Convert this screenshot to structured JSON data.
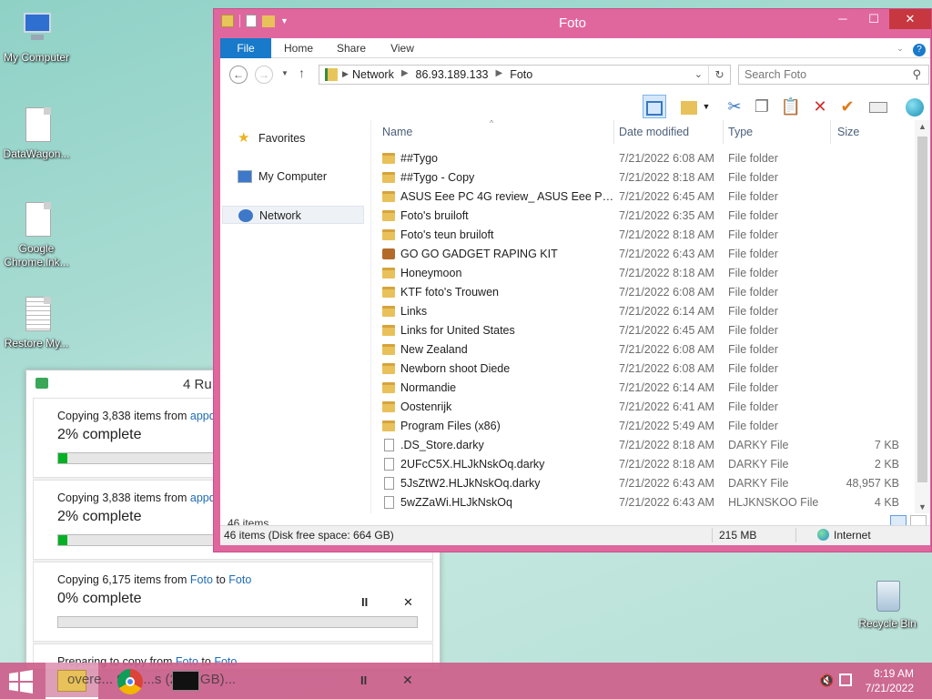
{
  "desktop": {
    "icons": [
      {
        "label": "My Computer"
      },
      {
        "label": "DataWagon..."
      },
      {
        "label": "Google Chrome.lnk..."
      },
      {
        "label": "Restore My..."
      }
    ],
    "recycle_bin": "Recycle Bin"
  },
  "copy_dialog": {
    "title": "4 Ru",
    "items": [
      {
        "prefix": "Copying 3,838 items from ",
        "source": "appda",
        "to": "",
        "dest": "",
        "percent_text": "2% complete",
        "progress": 0.025
      },
      {
        "prefix": "Copying 3,838 items from ",
        "source": "appda",
        "to": "",
        "dest": "",
        "percent_text": "2% complete",
        "progress": 0.025
      },
      {
        "prefix": "Copying 6,175 items from ",
        "source": "Foto",
        "to": " to ",
        "dest": "Foto",
        "percent_text": "0% complete",
        "progress": 0.0
      },
      {
        "prefix": "Preparing to copy from ",
        "source": "Foto",
        "to": " to ",
        "dest": "Foto",
        "percent_text": "",
        "progress": 0.0
      }
    ],
    "pause_icon": "II",
    "close_icon": "✕"
  },
  "explorer": {
    "title": "Foto",
    "tabs": {
      "file": "File",
      "home": "Home",
      "share": "Share",
      "view": "View"
    },
    "address": {
      "crumbs": [
        "Network",
        "86.93.189.133",
        "Foto"
      ]
    },
    "search": {
      "placeholder": "Search Foto"
    },
    "nav": {
      "favorites": "Favorites",
      "my_computer": "My Computer",
      "network": "Network"
    },
    "columns": {
      "name": "Name",
      "date": "Date modified",
      "type": "Type",
      "size": "Size"
    },
    "rows": [
      {
        "icon": "folder",
        "name": "##Tygo",
        "date": "7/21/2022 6:08 AM",
        "type": "File folder",
        "size": ""
      },
      {
        "icon": "folder",
        "name": "##Tygo - Copy",
        "date": "7/21/2022 8:18 AM",
        "type": "File folder",
        "size": ""
      },
      {
        "icon": "folder",
        "name": "ASUS Eee PC 4G review_ ASUS Eee PC 4G ...",
        "date": "7/21/2022 6:45 AM",
        "type": "File folder",
        "size": ""
      },
      {
        "icon": "folder",
        "name": "Foto's bruiloft",
        "date": "7/21/2022 6:35 AM",
        "type": "File folder",
        "size": ""
      },
      {
        "icon": "folder",
        "name": "Foto's teun bruiloft",
        "date": "7/21/2022 8:18 AM",
        "type": "File folder",
        "size": ""
      },
      {
        "icon": "package",
        "name": "GO GO GADGET RAPING KIT",
        "date": "7/21/2022 6:43 AM",
        "type": "File folder",
        "size": ""
      },
      {
        "icon": "folder",
        "name": "Honeymoon",
        "date": "7/21/2022 8:18 AM",
        "type": "File folder",
        "size": ""
      },
      {
        "icon": "folder",
        "name": "KTF foto's Trouwen",
        "date": "7/21/2022 6:08 AM",
        "type": "File folder",
        "size": ""
      },
      {
        "icon": "folder",
        "name": "Links",
        "date": "7/21/2022 6:14 AM",
        "type": "File folder",
        "size": ""
      },
      {
        "icon": "folder",
        "name": "Links for United States",
        "date": "7/21/2022 6:45 AM",
        "type": "File folder",
        "size": ""
      },
      {
        "icon": "folder",
        "name": "New Zealand",
        "date": "7/21/2022 6:08 AM",
        "type": "File folder",
        "size": ""
      },
      {
        "icon": "folder",
        "name": "Newborn shoot Diede",
        "date": "7/21/2022 6:08 AM",
        "type": "File folder",
        "size": ""
      },
      {
        "icon": "folder",
        "name": "Normandie",
        "date": "7/21/2022 6:14 AM",
        "type": "File folder",
        "size": ""
      },
      {
        "icon": "folder",
        "name": "Oostenrijk",
        "date": "7/21/2022 6:41 AM",
        "type": "File folder",
        "size": ""
      },
      {
        "icon": "folder",
        "name": "Program Files (x86)",
        "date": "7/21/2022 5:49 AM",
        "type": "File folder",
        "size": ""
      },
      {
        "icon": "file",
        "name": ".DS_Store.darky",
        "date": "7/21/2022 8:18 AM",
        "type": "DARKY File",
        "size": "7 KB"
      },
      {
        "icon": "file",
        "name": "2UFcC5X.HLJkNskOq.darky",
        "date": "7/21/2022 8:18 AM",
        "type": "DARKY File",
        "size": "2 KB"
      },
      {
        "icon": "file",
        "name": "5JsZtW2.HLJkNskOq.darky",
        "date": "7/21/2022 6:43 AM",
        "type": "DARKY File",
        "size": "48,957 KB"
      },
      {
        "icon": "file",
        "name": "5wZZaWi.HLJkNskOq",
        "date": "7/21/2022 6:43 AM",
        "type": "HLJKNSKOO File",
        "size": "4 KB"
      }
    ],
    "items_count": "46 items",
    "status": {
      "left": "46 items (Disk free space: 664 GB)",
      "size": "215 MB",
      "zone": "Internet"
    }
  },
  "taskbar": {
    "preview_text": "overe... 957 ...s (20.8 GB)...",
    "clock_time": "8:19 AM",
    "clock_date": "7/21/2022"
  },
  "colors": {
    "accent": "#1979ca",
    "window_frame": "#e0679e",
    "progress": "#06b025",
    "taskbar": "#cd5f8c"
  }
}
